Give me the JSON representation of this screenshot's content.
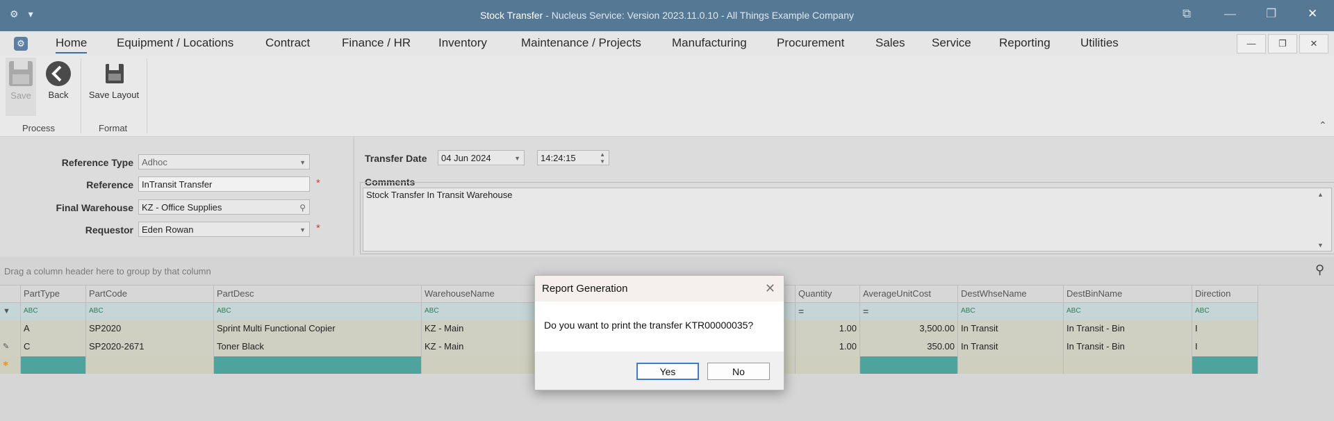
{
  "titlebar": {
    "doc_title": "Stock Transfer",
    "product": " - Nucleus Service: Version 2023.11.0.10 - All Things Example Company",
    "settings_glyph": "⚙",
    "dropdown_glyph": "▾"
  },
  "menu": {
    "items": [
      "Home",
      "Equipment / Locations",
      "Contract",
      "Finance / HR",
      "Inventory",
      "Maintenance / Projects",
      "Manufacturing",
      "Procurement",
      "Sales",
      "Service",
      "Reporting",
      "Utilities"
    ]
  },
  "ribbon": {
    "save_label": "Save",
    "back_label": "Back",
    "save_layout_label": "Save Layout",
    "group_process": "Process",
    "group_format": "Format"
  },
  "form": {
    "reference_type_label": "Reference Type",
    "reference_type_value": "Adhoc",
    "reference_label": "Reference",
    "reference_value": "InTransit Transfer",
    "final_warehouse_label": "Final Warehouse",
    "final_warehouse_value": "KZ - Office Supplies",
    "requestor_label": "Requestor",
    "requestor_value": "Eden Rowan",
    "required_mark": "*",
    "transfer_date_label": "Transfer Date",
    "transfer_date_value": "04 Jun 2024",
    "transfer_time_value": "14:24:15",
    "comments_label": "Comments",
    "comments_value": "Stock Transfer In Transit Warehouse"
  },
  "grid": {
    "group_hint": "Drag a column header here to group by that column",
    "columns": [
      "PartType",
      "PartCode",
      "PartDesc",
      "WarehouseName",
      "Quantity",
      "AverageUnitCost",
      "DestWhseName",
      "DestBinName",
      "Direction"
    ],
    "filter_text": "ABC",
    "filter_num": "=",
    "rows": [
      {
        "PartType": "A",
        "PartCode": "SP2020",
        "PartDesc": "Sprint Multi Functional Copier",
        "WarehouseName": "KZ - Main",
        "Quantity": "1.00",
        "AverageUnitCost": "3,500.00",
        "DestWhseName": "In Transit",
        "DestBinName": "In Transit - Bin",
        "Direction": "I"
      },
      {
        "PartType": "C",
        "PartCode": "SP2020-2671",
        "PartDesc": "Toner Black",
        "WarehouseName": "KZ - Main",
        "Quantity": "1.00",
        "AverageUnitCost": "350.00",
        "DestWhseName": "In Transit",
        "DestBinName": "In Transit - Bin",
        "Direction": "I"
      }
    ]
  },
  "dialog": {
    "title": "Report Generation",
    "message": "Do you want to print the transfer KTR00000035?",
    "yes_label": "Yes",
    "no_label": "No"
  }
}
